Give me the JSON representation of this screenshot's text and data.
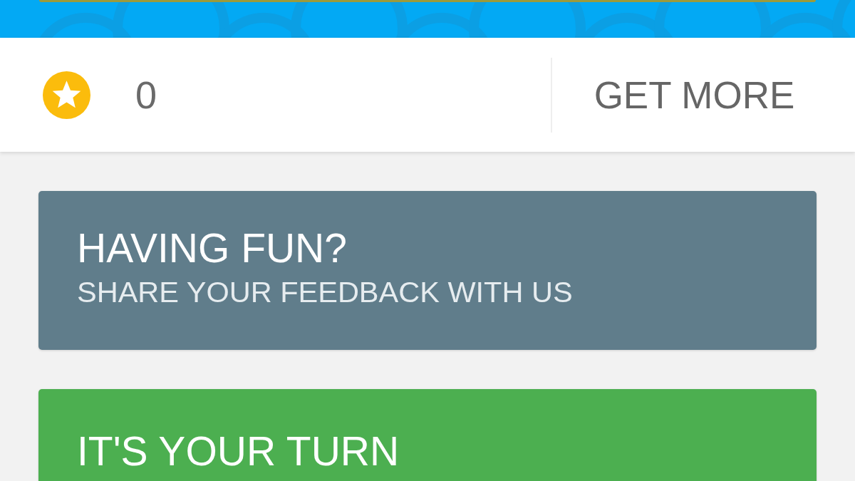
{
  "balance": {
    "count": "0",
    "action": "GET MORE"
  },
  "cards": [
    {
      "title": "HAVING FUN?",
      "subtitle": "SHARE YOUR FEEDBACK WITH US",
      "color": "#607d8b"
    },
    {
      "title": "IT'S YOUR TURN",
      "color": "#4caf50"
    }
  ]
}
